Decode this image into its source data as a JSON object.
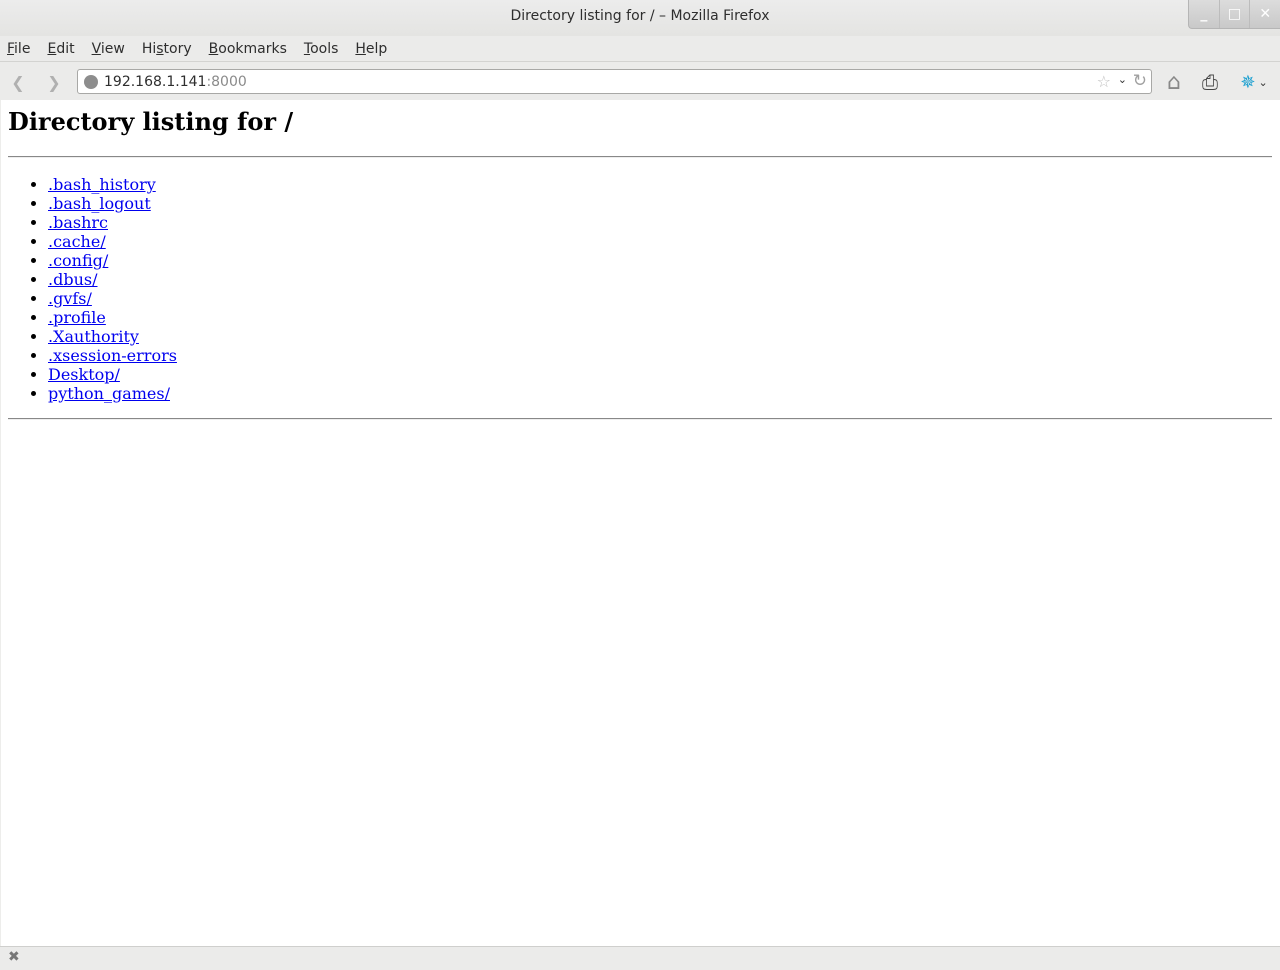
{
  "window": {
    "title": "Directory listing for / – Mozilla Firefox",
    "controls": {
      "minimize": "_",
      "maximize": "□",
      "close": "✕"
    }
  },
  "menu": [
    {
      "label": "File",
      "accel": "F",
      "rest": "ile"
    },
    {
      "label": "Edit",
      "accel": "E",
      "rest": "dit"
    },
    {
      "label": "View",
      "accel": "V",
      "rest": "iew"
    },
    {
      "label": "History",
      "pre": "Hi",
      "accel": "s",
      "rest": "tory"
    },
    {
      "label": "Bookmarks",
      "accel": "B",
      "rest": "ookmarks"
    },
    {
      "label": "Tools",
      "accel": "T",
      "rest": "ools"
    },
    {
      "label": "Help",
      "accel": "H",
      "rest": "elp"
    }
  ],
  "navbar": {
    "back_icon": "❮",
    "forward_icon": "❯",
    "url_host": "192.168.1.141",
    "url_port": ":8000",
    "star_icon": "☆",
    "dropdown_icon": "⌄",
    "reload_icon": "↻",
    "home_icon": "⌂",
    "print_icon": "⎙",
    "addon_icon": "✵",
    "addon_dropdown_icon": "⌄"
  },
  "page": {
    "heading": "Directory listing for /",
    "entries": [
      ".bash_history",
      ".bash_logout",
      ".bashrc",
      ".cache/",
      ".config/",
      ".dbus/",
      ".gvfs/",
      ".profile",
      ".Xauthority",
      ".xsession-errors",
      "Desktop/",
      "python_games/"
    ]
  },
  "statusbar": {
    "close_icon": "✖"
  }
}
